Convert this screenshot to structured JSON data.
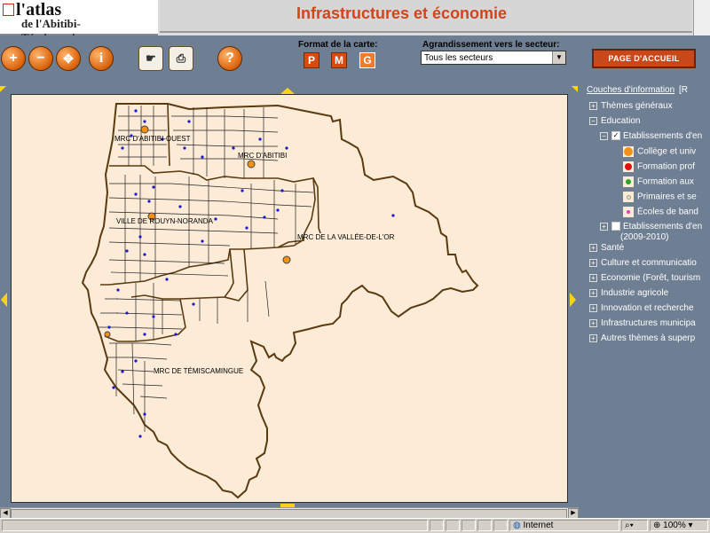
{
  "logo": {
    "line1": "l'atlas",
    "line2": "de l'Abitibi-Témiscamingue"
  },
  "title": "Infrastructures et économie",
  "toolbar": {
    "tools": [
      {
        "name": "zoom-in-icon",
        "glyph": "+"
      },
      {
        "name": "zoom-out-icon",
        "glyph": "−"
      },
      {
        "name": "pan-icon",
        "glyph": "✥"
      },
      {
        "name": "info-icon",
        "glyph": "i"
      },
      {
        "name": "identify-icon",
        "glyph": "☛"
      },
      {
        "name": "print-icon",
        "glyph": "⎙"
      },
      {
        "name": "help-icon",
        "glyph": "?"
      }
    ],
    "format_label": "Format de la carte:",
    "formats": [
      "P",
      "M",
      "G"
    ],
    "format_selected": "G",
    "agrandissement_label": "Agrandissement vers le secteur:",
    "sector_value": "Tous les secteurs",
    "home_label": "PAGE D'ACCUEIL"
  },
  "map": {
    "labels": [
      "MRC D'ABITIBI-OUEST",
      "MRC D'ABITIBI",
      "VILLE DE ROUYN-NORANDA",
      "MRC DE LA VALLÉE-DE-L'OR",
      "MRC DE TÉMISCAMINGUE"
    ]
  },
  "legend": {
    "header": "Couches d'information",
    "header_right": "[R",
    "items": [
      {
        "label": "Thèmes généraux",
        "type": "group"
      },
      {
        "label": "Éducation",
        "type": "group-open"
      },
      {
        "label": "Établissements d'en",
        "type": "checked"
      },
      {
        "label": "Collège et univ",
        "type": "sym",
        "color": "#f39018"
      },
      {
        "label": "Formation prof",
        "type": "sym",
        "color": "#e01010"
      },
      {
        "label": "Formation aux",
        "type": "sym",
        "color": "#22a822"
      },
      {
        "label": "Primaires et se",
        "type": "sym",
        "color": "#f6e8a0"
      },
      {
        "label": "Écoles de band",
        "type": "sym",
        "color": "#e040c0"
      },
      {
        "label": "Établissements d'en",
        "type": "unchecked"
      },
      {
        "label": "(2009-2010)",
        "type": "sub"
      },
      {
        "label": "Santé",
        "type": "group"
      },
      {
        "label": "Culture et communicatio",
        "type": "group"
      },
      {
        "label": "Économie (Forêt, tourism",
        "type": "group"
      },
      {
        "label": "Industrie agricole",
        "type": "group"
      },
      {
        "label": "Innovation et recherche",
        "type": "group"
      },
      {
        "label": "Infrastructures municipa",
        "type": "group"
      },
      {
        "label": "Autres thèmes à superp",
        "type": "group"
      }
    ]
  },
  "status": {
    "zone": "Internet",
    "zoom": "100%"
  }
}
